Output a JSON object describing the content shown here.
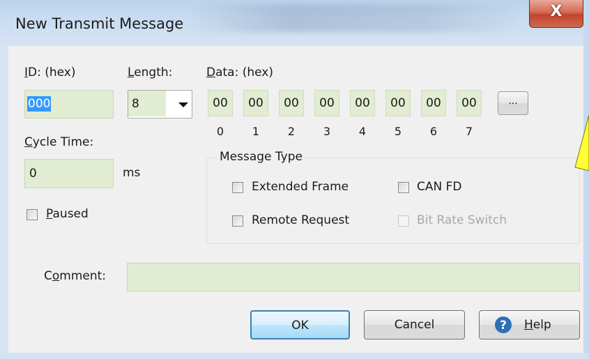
{
  "window": {
    "title": "New Transmit Message",
    "close_glyph": "X"
  },
  "id": {
    "label_prefix": "I",
    "label_rest": "D: (hex)",
    "value": "000"
  },
  "length": {
    "label_prefix": "L",
    "label_rest": "ength:",
    "value": "8"
  },
  "data": {
    "label_prefix": "D",
    "label_rest": "ata: (hex)",
    "bytes": [
      "00",
      "00",
      "00",
      "00",
      "00",
      "00",
      "00",
      "00"
    ],
    "indices": [
      "0",
      "1",
      "2",
      "3",
      "4",
      "5",
      "6",
      "7"
    ],
    "more_label": "..."
  },
  "cycle_time": {
    "label_prefix": "C",
    "label_rest": "ycle Time:",
    "value": "0",
    "unit": "ms"
  },
  "paused": {
    "label_prefix": "P",
    "label_rest": "aused",
    "checked": false
  },
  "message_type": {
    "title": "Message Type",
    "extended_frame": {
      "label": "Extended Frame",
      "checked": false
    },
    "remote_request": {
      "label": "Remote Request",
      "checked": false
    },
    "can_fd": {
      "label": "CAN FD",
      "checked": false
    },
    "bit_rate_switch": {
      "label": "Bit Rate Switch",
      "checked": false,
      "enabled": false
    }
  },
  "comment": {
    "label_a": "C",
    "label_u": "o",
    "label_b": "mment:",
    "value": ""
  },
  "buttons": {
    "ok": "OK",
    "cancel": "Cancel",
    "help_prefix": "H",
    "help_rest": "elp"
  },
  "colors": {
    "field_bg": "#e2ecd2",
    "title_bar": "#c9dcf1",
    "close_red": "#c2442c",
    "help_icon": "#2f6fb8",
    "annotation_yellow": "#ffff33"
  }
}
